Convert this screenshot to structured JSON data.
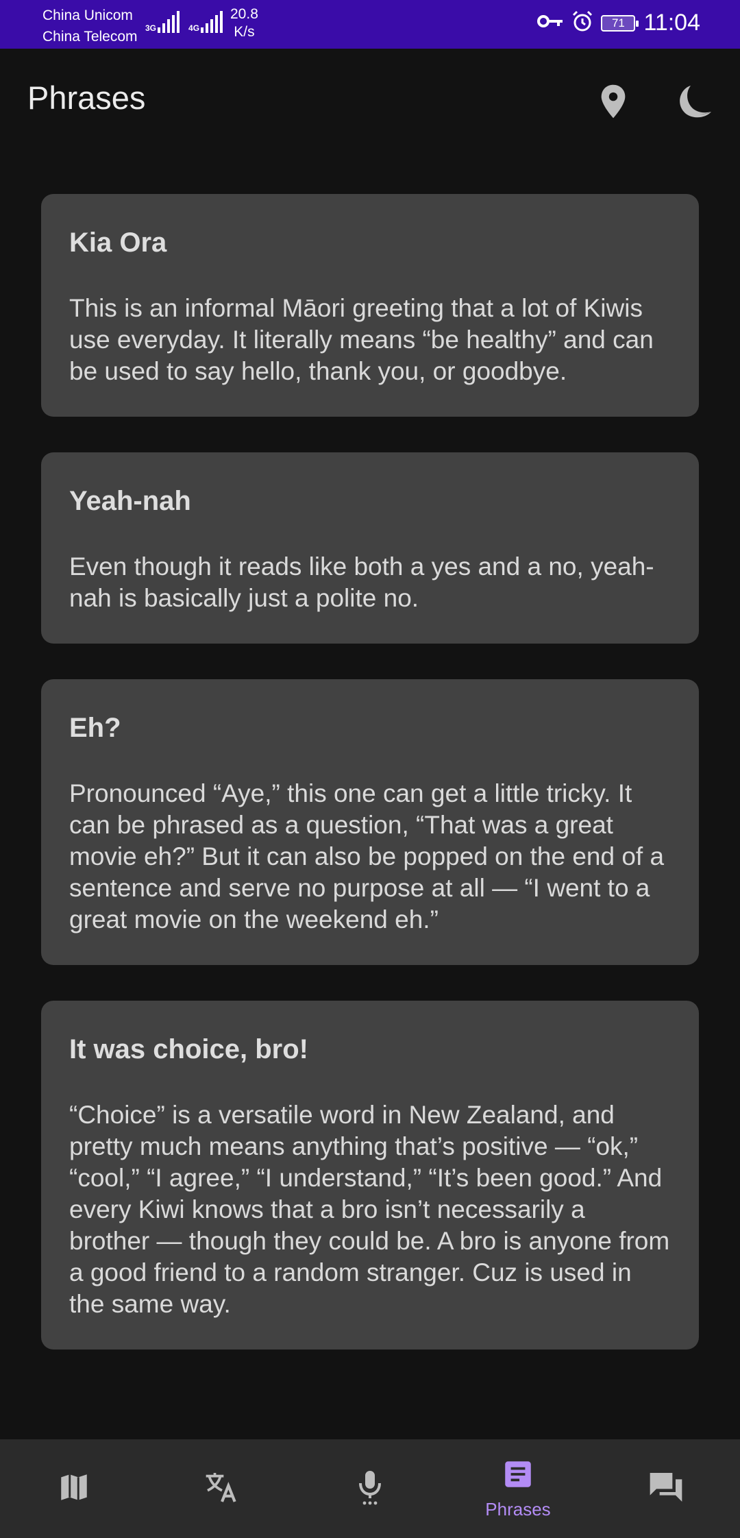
{
  "status_bar": {
    "carrier_1": "China Unicom",
    "carrier_2": "China Telecom",
    "network_1": "3G",
    "network_2": "4G",
    "speed_value": "20.8",
    "speed_unit": "K/s",
    "battery": "71",
    "time": "11:04",
    "background_color": "#3a0ca8"
  },
  "app_bar": {
    "title": "Phrases",
    "location_icon": "location-pin-icon",
    "theme_icon": "moon-icon"
  },
  "phrases": [
    {
      "title": "Kia Ora",
      "description": "This is an informal Māori greeting that a lot of Kiwis use everyday. It literally means “be healthy” and can be used to say hello, thank you, or goodbye."
    },
    {
      "title": "Yeah-nah",
      "description": "Even though it reads like both a yes and a no, yeah-nah is basically just a polite no."
    },
    {
      "title": "Eh?",
      "description": "Pronounced “Aye,” this one can get a little tricky. It can be phrased as a question, “That was a great movie eh?” But it can also be popped on the end of a sentence and serve no purpose at all — “I went to a great movie on the weekend eh.”"
    },
    {
      "title": "It was choice, bro!",
      "description": "“Choice” is a versatile word in New Zealand, and pretty much means anything that’s positive — “ok,” “cool,” “I agree,” “I understand,” “It’s been good.” And every Kiwi knows that a bro isn’t necessarily a brother — though they could be. A bro is anyone from a good friend to a random stranger. Cuz is used in the same way."
    }
  ],
  "bottom_nav": {
    "items": [
      {
        "icon": "map-icon",
        "label": ""
      },
      {
        "icon": "translate-icon",
        "label": ""
      },
      {
        "icon": "microphone-icon",
        "label": ""
      },
      {
        "icon": "article-icon",
        "label": "Phrases",
        "active": true
      },
      {
        "icon": "chat-icon",
        "label": ""
      }
    ],
    "active_color": "#b38cf5",
    "inactive_color": "#bdbdbd"
  }
}
